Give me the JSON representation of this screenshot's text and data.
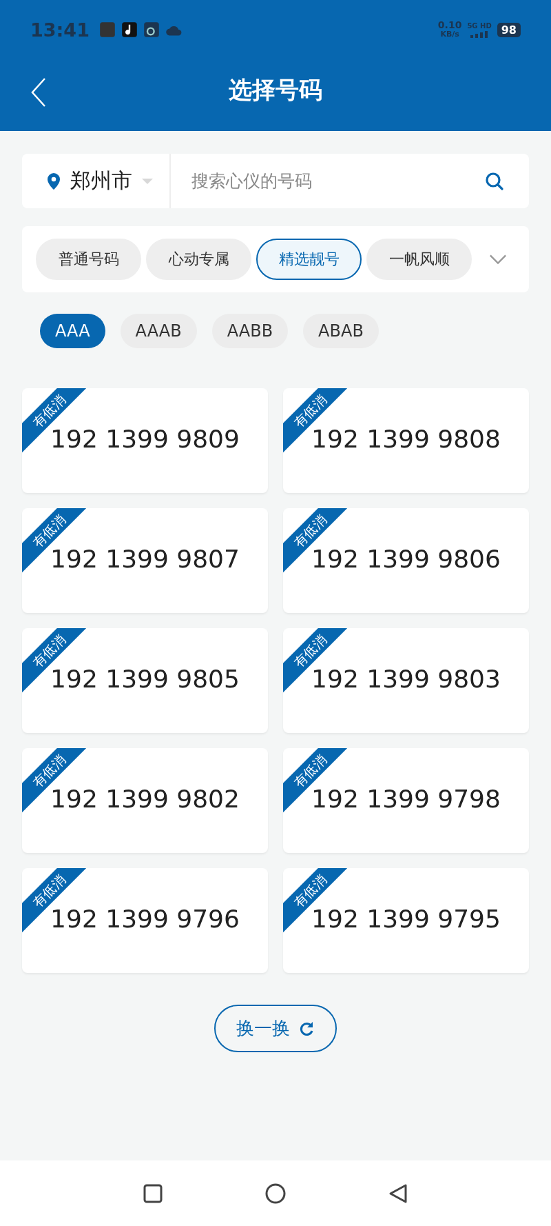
{
  "status_bar": {
    "time": "13:41",
    "speed": "0.10",
    "speed_unit": "KB/s",
    "network": "5G HD",
    "battery": "98"
  },
  "header": {
    "title": "选择号码"
  },
  "search": {
    "city": "郑州市",
    "placeholder": "搜索心仪的号码"
  },
  "categories": [
    {
      "label": "普通号码",
      "selected": false
    },
    {
      "label": "心动专属",
      "selected": false
    },
    {
      "label": "精选靓号",
      "selected": true
    },
    {
      "label": "一帆风顺",
      "selected": false
    }
  ],
  "patterns": [
    {
      "label": "AAA",
      "selected": true
    },
    {
      "label": "AAAB",
      "selected": false
    },
    {
      "label": "AABB",
      "selected": false
    },
    {
      "label": "ABAB",
      "selected": false
    }
  ],
  "numbers": [
    {
      "number": "192 1399 9809",
      "tag": "有低消"
    },
    {
      "number": "192 1399 9808",
      "tag": "有低消"
    },
    {
      "number": "192 1399 9807",
      "tag": "有低消"
    },
    {
      "number": "192 1399 9806",
      "tag": "有低消"
    },
    {
      "number": "192 1399 9805",
      "tag": "有低消"
    },
    {
      "number": "192 1399 9803",
      "tag": "有低消"
    },
    {
      "number": "192 1399 9802",
      "tag": "有低消"
    },
    {
      "number": "192 1399 9798",
      "tag": "有低消"
    },
    {
      "number": "192 1399 9796",
      "tag": "有低消"
    },
    {
      "number": "192 1399 9795",
      "tag": "有低消"
    }
  ],
  "refresh_button": "换一换"
}
